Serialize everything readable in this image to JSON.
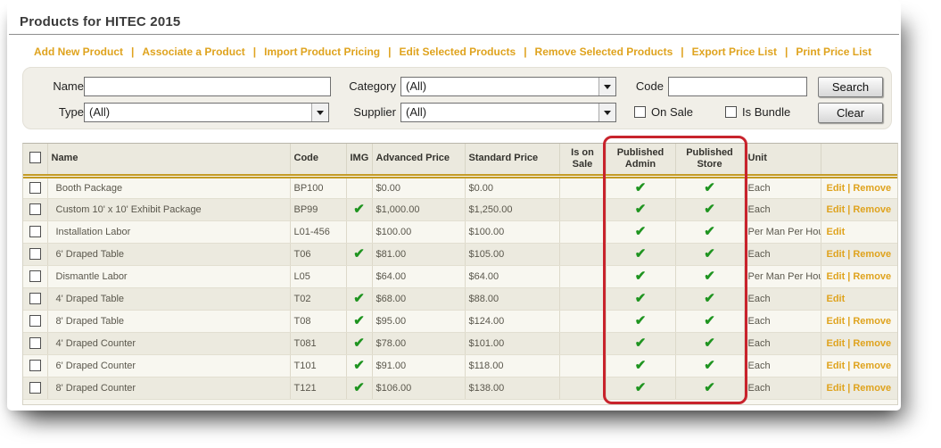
{
  "page": {
    "title": "Products for HITEC 2015"
  },
  "toolbar": {
    "separator": "|",
    "links": [
      "Add New Product",
      "Associate a Product",
      "Import Product Pricing",
      "Edit Selected Products",
      "Remove Selected Products",
      "Export Price List",
      "Print Price List"
    ]
  },
  "filters": {
    "name_label": "Name",
    "name_value": "",
    "category_label": "Category",
    "category_value": "(All)",
    "code_label": "Code",
    "code_value": "",
    "type_label": "Type",
    "type_value": "(All)",
    "supplier_label": "Supplier",
    "supplier_value": "(All)",
    "on_sale_label": "On Sale",
    "on_sale_checked": false,
    "is_bundle_label": "Is Bundle",
    "is_bundle_checked": false,
    "search_label": "Search",
    "clear_label": "Clear"
  },
  "icons": {
    "check": "✔",
    "dropdown": "chevron-down"
  },
  "colors": {
    "accent_gold": "#DFA31E",
    "check_green": "#1F9420",
    "highlight_red": "#C8232C",
    "header_rule_gold": "#C49B26"
  },
  "table": {
    "actions_separator": "|",
    "columns": {
      "name": "Name",
      "code": "Code",
      "img": "IMG",
      "advanced_price": "Advanced Price",
      "standard_price": "Standard Price",
      "is_on_sale": "Is on Sale",
      "published_admin": "Published Admin",
      "published_store": "Published Store",
      "unit": "Unit"
    },
    "rows": [
      {
        "name": "Booth Package",
        "code": "BP100",
        "img": false,
        "advanced_price": "$0.00",
        "standard_price": "$0.00",
        "is_on_sale": false,
        "published_admin": true,
        "published_store": true,
        "unit": "Each",
        "actions": {
          "edit": "Edit",
          "remove": "Remove"
        }
      },
      {
        "name": "Custom 10' x 10' Exhibit Package",
        "code": "BP99",
        "img": true,
        "advanced_price": "$1,000.00",
        "standard_price": "$1,250.00",
        "is_on_sale": false,
        "published_admin": true,
        "published_store": true,
        "unit": "Each",
        "actions": {
          "edit": "Edit",
          "remove": "Remove"
        }
      },
      {
        "name": "Installation Labor",
        "code": "L01-456",
        "img": false,
        "advanced_price": "$100.00",
        "standard_price": "$100.00",
        "is_on_sale": false,
        "published_admin": true,
        "published_store": true,
        "unit": "Per Man Per Hour",
        "actions": {
          "edit": "Edit"
        }
      },
      {
        "name": "6' Draped Table",
        "code": "T06",
        "img": true,
        "advanced_price": "$81.00",
        "standard_price": "$105.00",
        "is_on_sale": false,
        "published_admin": true,
        "published_store": true,
        "unit": "Each",
        "actions": {
          "edit": "Edit",
          "remove": "Remove"
        }
      },
      {
        "name": "Dismantle Labor",
        "code": "L05",
        "img": false,
        "advanced_price": "$64.00",
        "standard_price": "$64.00",
        "is_on_sale": false,
        "published_admin": true,
        "published_store": true,
        "unit": "Per Man Per Hour",
        "actions": {
          "edit": "Edit",
          "remove": "Remove"
        }
      },
      {
        "name": "4' Draped Table",
        "code": "T02",
        "img": true,
        "advanced_price": "$68.00",
        "standard_price": "$88.00",
        "is_on_sale": false,
        "published_admin": true,
        "published_store": true,
        "unit": "Each",
        "actions": {
          "edit": "Edit"
        }
      },
      {
        "name": "8' Draped Table",
        "code": "T08",
        "img": true,
        "advanced_price": "$95.00",
        "standard_price": "$124.00",
        "is_on_sale": false,
        "published_admin": true,
        "published_store": true,
        "unit": "Each",
        "actions": {
          "edit": "Edit",
          "remove": "Remove"
        }
      },
      {
        "name": "4' Draped Counter",
        "code": "T081",
        "img": true,
        "advanced_price": "$78.00",
        "standard_price": "$101.00",
        "is_on_sale": false,
        "published_admin": true,
        "published_store": true,
        "unit": "Each",
        "actions": {
          "edit": "Edit",
          "remove": "Remove"
        }
      },
      {
        "name": "6' Draped Counter",
        "code": "T101",
        "img": true,
        "advanced_price": "$91.00",
        "standard_price": "$118.00",
        "is_on_sale": false,
        "published_admin": true,
        "published_store": true,
        "unit": "Each",
        "actions": {
          "edit": "Edit",
          "remove": "Remove"
        }
      },
      {
        "name": "8' Draped Counter",
        "code": "T121",
        "img": true,
        "advanced_price": "$106.00",
        "standard_price": "$138.00",
        "is_on_sale": false,
        "published_admin": true,
        "published_store": true,
        "unit": "Each",
        "actions": {
          "edit": "Edit",
          "remove": "Remove"
        }
      }
    ]
  },
  "annotation": {
    "highlighted_columns": "Published Admin and Published Store"
  }
}
